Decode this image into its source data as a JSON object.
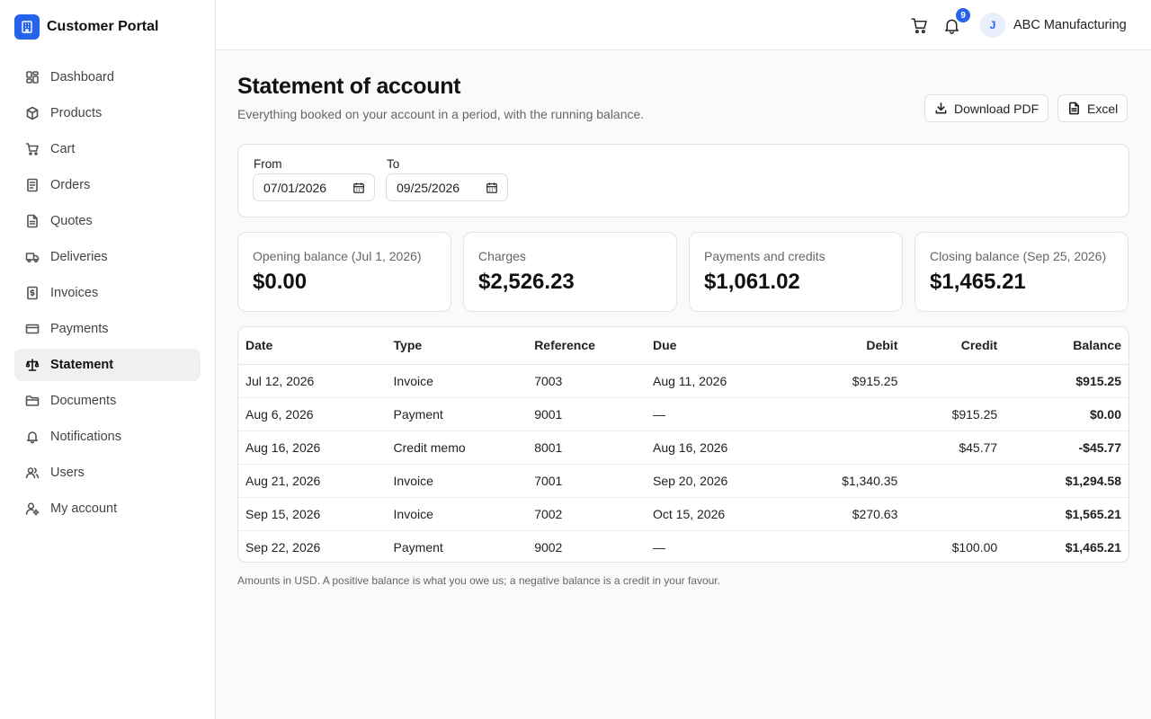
{
  "brand": {
    "name": "Customer Portal"
  },
  "sidebar": {
    "items": [
      {
        "label": "Dashboard",
        "icon": "dashboard-icon"
      },
      {
        "label": "Products",
        "icon": "box-icon"
      },
      {
        "label": "Cart",
        "icon": "cart-icon"
      },
      {
        "label": "Orders",
        "icon": "document-icon"
      },
      {
        "label": "Quotes",
        "icon": "file-text-icon"
      },
      {
        "label": "Deliveries",
        "icon": "truck-icon"
      },
      {
        "label": "Invoices",
        "icon": "receipt-icon"
      },
      {
        "label": "Payments",
        "icon": "credit-card-icon"
      },
      {
        "label": "Statement",
        "icon": "scale-icon",
        "active": true
      },
      {
        "label": "Documents",
        "icon": "folder-icon"
      },
      {
        "label": "Notifications",
        "icon": "bell-icon"
      },
      {
        "label": "Users",
        "icon": "users-icon"
      },
      {
        "label": "My account",
        "icon": "user-cog-icon"
      }
    ]
  },
  "topbar": {
    "notification_count": "9",
    "avatar_initial": "J",
    "account_name": "ABC Manufacturing"
  },
  "page": {
    "title": "Statement of account",
    "subtitle": "Everything booked on your account in a period, with the running balance.",
    "download_pdf_label": "Download PDF",
    "excel_label": "Excel"
  },
  "filters": {
    "from_label": "From",
    "from_value": "07/01/2026",
    "to_label": "To",
    "to_value": "09/25/2026"
  },
  "summary": {
    "opening_label": "Opening balance (Jul 1, 2026)",
    "opening_value": "$0.00",
    "charges_label": "Charges",
    "charges_value": "$2,526.23",
    "payments_label": "Payments and credits",
    "payments_value": "$1,061.02",
    "closing_label": "Closing balance (Sep 25, 2026)",
    "closing_value": "$1,465.21"
  },
  "table": {
    "headers": {
      "date": "Date",
      "type": "Type",
      "reference": "Reference",
      "due": "Due",
      "debit": "Debit",
      "credit": "Credit",
      "balance": "Balance"
    },
    "rows": [
      {
        "date": "Jul 12, 2026",
        "type": "Invoice",
        "reference": "7003",
        "due": "Aug 11, 2026",
        "debit": "$915.25",
        "credit": "",
        "balance": "$915.25"
      },
      {
        "date": "Aug 6, 2026",
        "type": "Payment",
        "reference": "9001",
        "due": "—",
        "debit": "",
        "credit": "$915.25",
        "balance": "$0.00"
      },
      {
        "date": "Aug 16, 2026",
        "type": "Credit memo",
        "reference": "8001",
        "due": "Aug 16, 2026",
        "debit": "",
        "credit": "$45.77",
        "balance": "-$45.77"
      },
      {
        "date": "Aug 21, 2026",
        "type": "Invoice",
        "reference": "7001",
        "due": "Sep 20, 2026",
        "debit": "$1,340.35",
        "credit": "",
        "balance": "$1,294.58"
      },
      {
        "date": "Sep 15, 2026",
        "type": "Invoice",
        "reference": "7002",
        "due": "Oct 15, 2026",
        "debit": "$270.63",
        "credit": "",
        "balance": "$1,565.21"
      },
      {
        "date": "Sep 22, 2026",
        "type": "Payment",
        "reference": "9002",
        "due": "—",
        "debit": "",
        "credit": "$100.00",
        "balance": "$1,465.21"
      }
    ]
  },
  "footnote": "Amounts in USD. A positive balance is what you owe us; a negative balance is a credit in your favour.",
  "colors": {
    "accent": "#2563eb",
    "active_bg": "#f0f0f0",
    "border": "#e3e3e3"
  }
}
